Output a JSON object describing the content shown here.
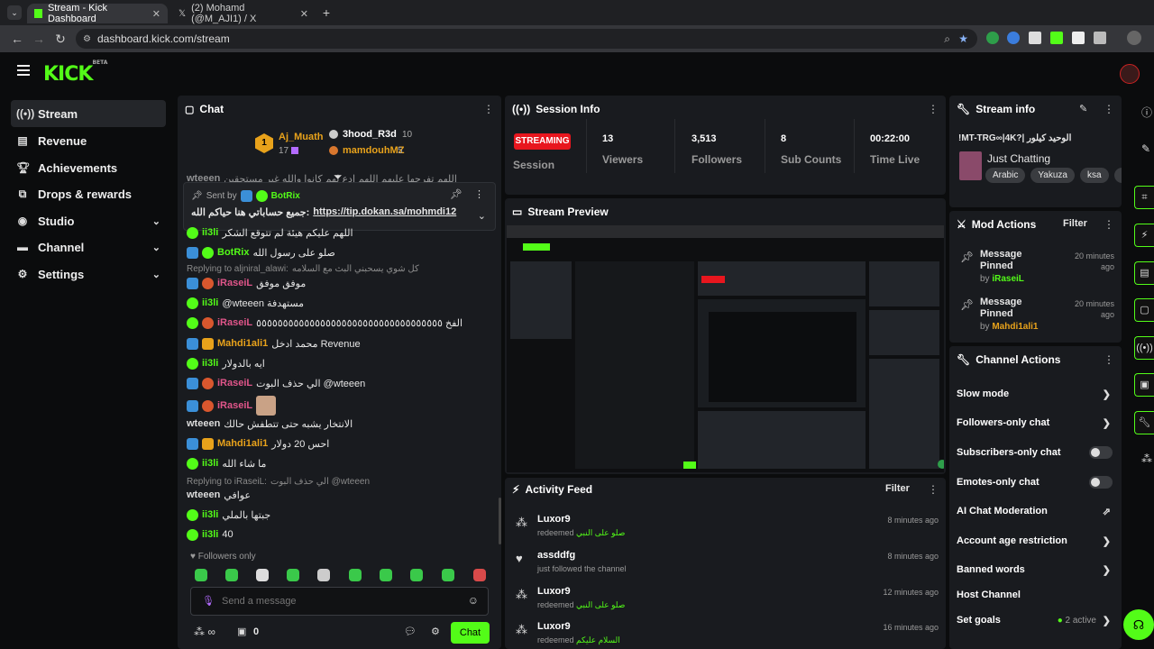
{
  "browser": {
    "tabs": [
      {
        "title": "Stream - Kick Dashboard",
        "active": true
      },
      {
        "title": "(2) Mohamd (@M_AJI1) / X",
        "active": false
      }
    ],
    "url": "dashboard.kick.com/stream"
  },
  "app": {
    "logo": "KICK",
    "beta": "BETA"
  },
  "sidebar": {
    "items": [
      {
        "label": "Stream",
        "icon": "broadcast-icon"
      },
      {
        "label": "Revenue",
        "icon": "revenue-icon"
      },
      {
        "label": "Achievements",
        "icon": "trophy-icon"
      },
      {
        "label": "Drops & rewards",
        "icon": "drops-icon"
      },
      {
        "label": "Studio",
        "icon": "studio-icon"
      },
      {
        "label": "Channel",
        "icon": "channel-icon"
      },
      {
        "label": "Settings",
        "icon": "gear-icon"
      }
    ]
  },
  "chat": {
    "title": "Chat",
    "leaderboard": {
      "first": {
        "name": "Aj_Muath",
        "count": "17"
      },
      "others": [
        {
          "name": "3hood_R3d",
          "count": "10"
        },
        {
          "name": "mamdouhMZ",
          "count": "5"
        }
      ]
    },
    "pinned": {
      "sent_by": "Sent by",
      "author": "BotRix",
      "text": "جميع حساباتي هنا حياكم الله:",
      "link": "https://tip.dokan.sa/mohmdi12"
    },
    "messages": [
      {
        "user": "wteeen",
        "text": "اللهم تفرجها عليهم اللهم ادع لهم كانوا والله غير مستحقين"
      },
      {
        "user": "ii3li",
        "text": "اللهم عليكم هيئة لم تتوقع الشكر"
      },
      {
        "user": "BotRix",
        "text": "صلو على رسول الله"
      },
      {
        "reply": "Replying to aljniral_alawi:",
        "reply_text": "كل شوي يسحبني البث مع السلامه"
      },
      {
        "user": "iRaseiL",
        "text": "موفق موفق"
      },
      {
        "user": "ii3li",
        "text": "@wteeen مستهدفة"
      },
      {
        "user": "iRaseiL",
        "text": "الفخ ٥٥٥٥٥٥٥٥٥٥٥٥٥٥٥٥٥٥٥٥٥٥٥٥٥٥٥٥٥٥٥٥٥٥٥"
      },
      {
        "user": "Mahdi1ali1",
        "text": "محمد ادخل Revenue"
      },
      {
        "user": "ii3li",
        "text": "ايه بالدولار"
      },
      {
        "user": "iRaseiL",
        "text": "الي حذف البوت @wteeen"
      },
      {
        "user": "iRaseiL",
        "text": ""
      },
      {
        "user": "wteeen",
        "text": "الانتخار يشبه حتى تتطفش حالك"
      },
      {
        "user": "Mahdi1ali1",
        "text": "احس 20 دولار"
      },
      {
        "user": "ii3li",
        "text": "ما شاء الله"
      },
      {
        "reply": "Replying to iRaseiL:",
        "reply_text": "الي حذف البوت @wteeen"
      },
      {
        "user": "wteeen",
        "text": "عوافي"
      },
      {
        "user": "ii3li",
        "text": "جبتها بالملي"
      },
      {
        "user": "ii3li",
        "text": "40"
      }
    ],
    "followers_only": "Followers only",
    "input_placeholder": "Send a message",
    "footer_count": "0",
    "chat_button": "Chat"
  },
  "session": {
    "title": "Session Info",
    "status_badge": "STREAMING",
    "status_label": "Session",
    "stats": [
      {
        "value": "13",
        "label": "Viewers"
      },
      {
        "value": "3,513",
        "label": "Followers"
      },
      {
        "value": "8",
        "label": "Sub Counts"
      },
      {
        "value": "00:22:00",
        "label": "Time Live"
      }
    ]
  },
  "preview": {
    "title": "Stream Preview"
  },
  "activity": {
    "title": "Activity Feed",
    "filter": "Filter",
    "items": [
      {
        "user": "Luxor9",
        "action": "redeemed",
        "reward": "صلو على النبي",
        "time": "8 minutes ago",
        "icon": "reward-icon"
      },
      {
        "user": "assddfg",
        "action": "just followed the channel",
        "reward": "",
        "time": "8 minutes ago",
        "icon": "heart-icon"
      },
      {
        "user": "Luxor9",
        "action": "redeemed",
        "reward": "صلو على النبي",
        "time": "12 minutes ago",
        "icon": "reward-icon"
      },
      {
        "user": "Luxor9",
        "action": "redeemed",
        "reward": "السلام عليكم",
        "time": "16 minutes ago",
        "icon": "reward-icon"
      }
    ]
  },
  "stream_info": {
    "title": "Stream info",
    "stream_title": "!MT-TRG∞|4K?| الوحيد كيلور",
    "category": "Just Chatting",
    "tags": [
      "Arabic",
      "Yakuza",
      "ksa",
      "m"
    ]
  },
  "mod_actions": {
    "title": "Mod Actions",
    "filter": "Filter",
    "items": [
      {
        "action": "Message Pinned",
        "by": "by",
        "user": "iRaseiL",
        "time": "20 minutes ago"
      },
      {
        "action": "Message Pinned",
        "by": "by",
        "user": "Mahdi1ali1",
        "time": "20 minutes ago"
      }
    ]
  },
  "channel_actions": {
    "title": "Channel Actions",
    "items": [
      {
        "label": "Slow mode",
        "control": "chevron"
      },
      {
        "label": "Followers-only chat",
        "control": "chevron"
      },
      {
        "label": "Subscribers-only chat",
        "control": "toggle"
      },
      {
        "label": "Emotes-only chat",
        "control": "toggle"
      },
      {
        "label": "AI Chat Moderation",
        "control": "external"
      },
      {
        "label": "Account age restriction",
        "control": "chevron"
      },
      {
        "label": "Banned words",
        "control": "chevron"
      },
      {
        "label": "Host Channel",
        "control": "none"
      },
      {
        "label": "Set goals",
        "control": "chevron"
      }
    ],
    "goals_active": "2 active"
  },
  "colors": {
    "accent": "#53fc18",
    "streaming": "#e8161e",
    "mod": "#3b8fd8",
    "vip": "#e8a21b",
    "panel": "#191b1f"
  }
}
